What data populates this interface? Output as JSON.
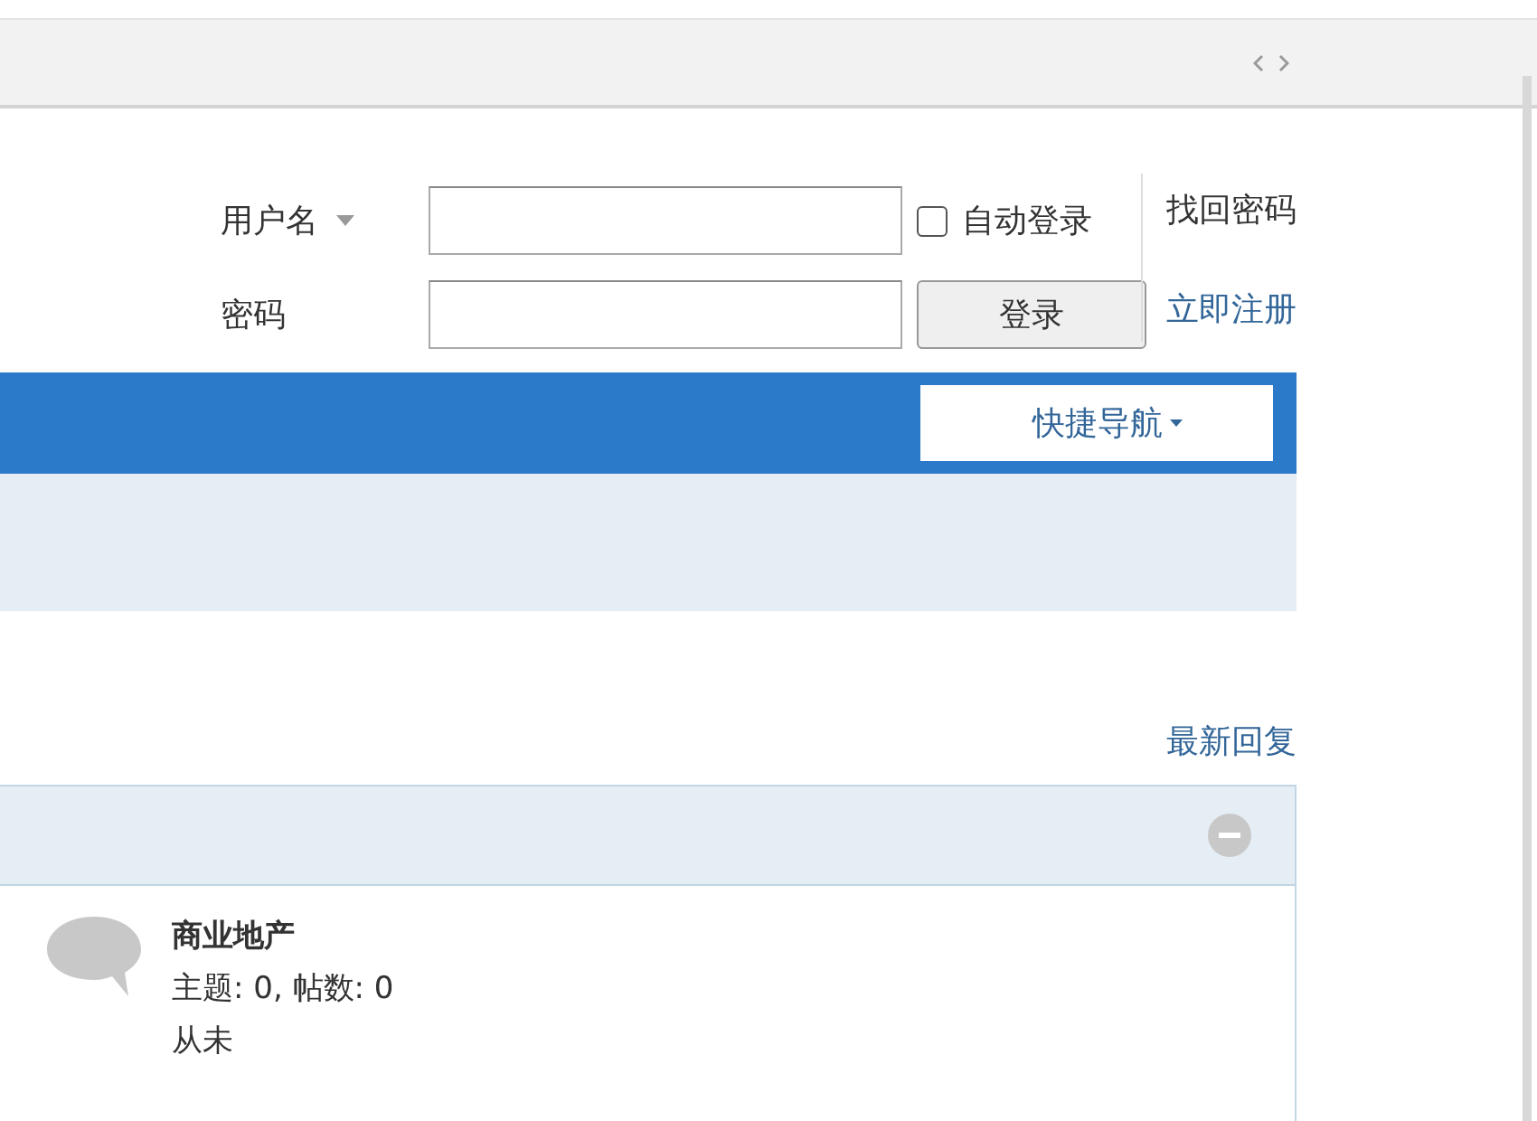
{
  "login": {
    "username_label": "用户名",
    "password_label": "密码",
    "auto_login": {
      "label": "自动登录",
      "checked": false
    },
    "submit": "登录",
    "links": [
      "找回密码",
      "立即注册"
    ]
  },
  "nav": {
    "quick_nav": "快捷导航"
  },
  "latest_replies": "最新回复",
  "category": {
    "expanded": true,
    "forums": [
      {
        "name": "商业地产",
        "stats": "主题: 0, 帖数: 0",
        "last_post": "从未"
      }
    ]
  }
}
